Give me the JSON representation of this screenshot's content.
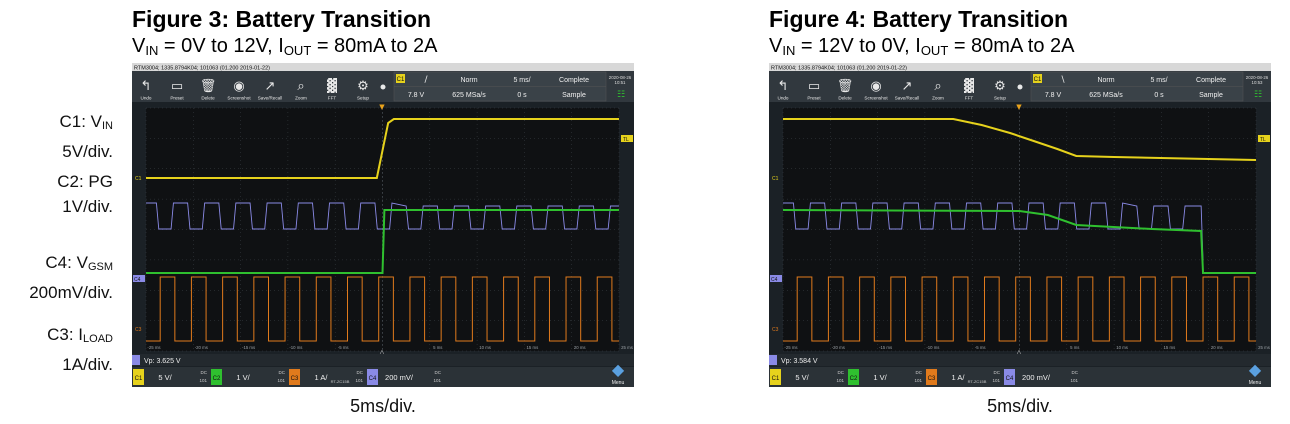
{
  "channel_labels": [
    {
      "name": "C1: V",
      "sub": "IN",
      "scale": "5V/div."
    },
    {
      "name": "C2: PG",
      "sub": "",
      "scale": "1V/div."
    },
    {
      "name": "C4: V",
      "sub": "GSM",
      "scale": "200mV/div."
    },
    {
      "name": "C3: I",
      "sub": "LOAD",
      "scale": "1A/div."
    }
  ],
  "figures": [
    {
      "title": "Figure 3: Battery Transition",
      "subtitle": {
        "p1": "V",
        "s1": "IN",
        "p2": " = 0V to 12V, I",
        "s2": "OUT",
        "p3": " = 80mA to 2A"
      },
      "xcaption": "5ms/div.",
      "scope": {
        "header": "RTM3004; 1335.8794K04; 101063 (01.200 2019-01-22)",
        "toolbar": [
          "Undo",
          "Preset",
          "Delete",
          "Screenshot",
          "Save/Recall",
          "Zoom",
          "FFT",
          "Setup"
        ],
        "trigger": {
          "mode": "Norm",
          "timebase": "5 ms/",
          "acq": "Complete",
          "level": "7.8 V",
          "rate": "625 MSa/s",
          "offset": "0 s",
          "sample": "Sample",
          "datetime": "2020-08-26 10:51"
        },
        "measure": "Vp: 3.625 V",
        "channels": [
          {
            "id": "C1",
            "scale": "5 V/",
            "coupling": "DC",
            "color": "#e6d21c"
          },
          {
            "id": "C2",
            "scale": "1 V/",
            "coupling": "DC",
            "color": "#2fc02f"
          },
          {
            "id": "C3",
            "scale": "1 A/",
            "coupling": "DC",
            "probe": "RT-ZC15B",
            "color": "#e07a1c"
          },
          {
            "id": "C4",
            "scale": "200 mV/",
            "coupling": "DC",
            "color": "#8a8ae6"
          }
        ],
        "menu": "Menu",
        "xticks": [
          "-25 ms",
          "-20 ms",
          "-15 ms",
          "-10 ms",
          "-5 ms",
          "5 ms",
          "10 ms",
          "15 ms",
          "20 ms",
          "25 ms"
        ]
      }
    },
    {
      "title": "Figure 4: Battery Transition",
      "subtitle": {
        "p1": "V",
        "s1": "IN",
        "p2": " = 12V to 0V, I",
        "s2": "OUT",
        "p3": " = 80mA to 2A"
      },
      "xcaption": "5ms/div.",
      "scope": {
        "header": "RTM3004; 1335.8794K04; 101063 (01.200 2019-01-22)",
        "toolbar": [
          "Undo",
          "Preset",
          "Delete",
          "Screenshot",
          "Save/Recall",
          "Zoom",
          "FFT",
          "Setup"
        ],
        "trigger": {
          "mode": "Norm",
          "timebase": "5 ms/",
          "acq": "Complete",
          "level": "7.8 V",
          "rate": "625 MSa/s",
          "offset": "0 s",
          "sample": "Sample",
          "datetime": "2020-08-26 10:53"
        },
        "measure": "Vp: 3.584 V",
        "channels": [
          {
            "id": "C1",
            "scale": "5 V/",
            "coupling": "DC",
            "color": "#e6d21c"
          },
          {
            "id": "C2",
            "scale": "1 V/",
            "coupling": "DC",
            "color": "#2fc02f"
          },
          {
            "id": "C3",
            "scale": "1 A/",
            "coupling": "DC",
            "probe": "RT-ZC15B",
            "color": "#e07a1c"
          },
          {
            "id": "C4",
            "scale": "200 mV/",
            "coupling": "DC",
            "color": "#8a8ae6"
          }
        ],
        "menu": "Menu",
        "xticks": [
          "-25 ms",
          "-20 ms",
          "-15 ms",
          "-10 ms",
          "-5 ms",
          "5 ms",
          "10 ms",
          "15 ms",
          "20 ms",
          "25 ms"
        ]
      }
    }
  ]
}
